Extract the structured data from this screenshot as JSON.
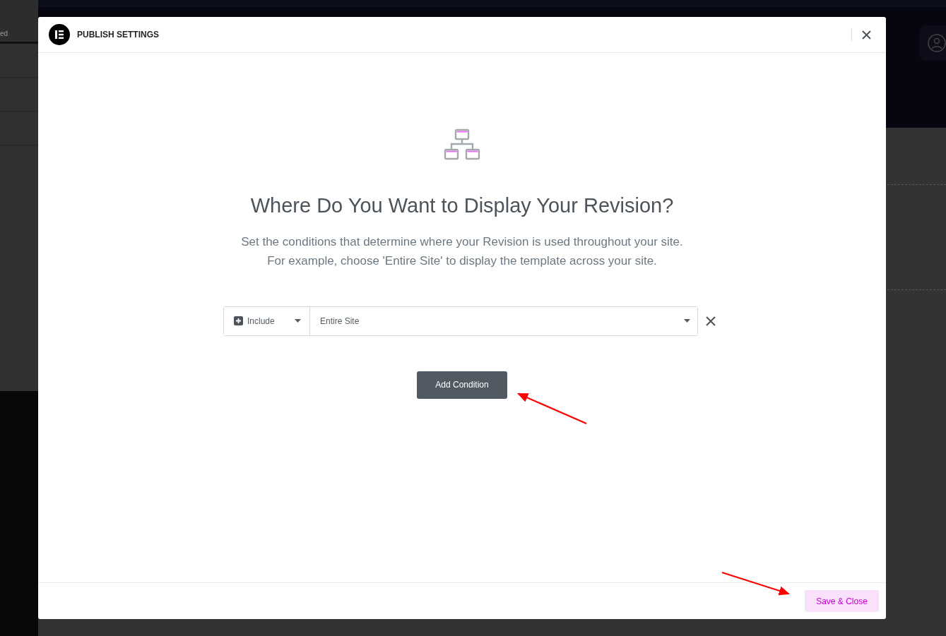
{
  "background": {
    "tab_fragment": "ed"
  },
  "dialog": {
    "title": "PUBLISH SETTINGS"
  },
  "heading": "Where Do You Want to Display Your Revision?",
  "description": [
    "Set the conditions that determine where your Revision is used throughout your site.",
    "For example, choose 'Entire Site' to display the template across your site."
  ],
  "conditions": [
    {
      "type": "Include",
      "value": "Entire Site"
    }
  ],
  "add_button": "Add Condition",
  "footer": {
    "save_button": "Save & Close"
  }
}
